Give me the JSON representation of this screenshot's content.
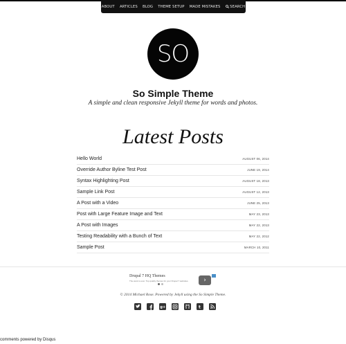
{
  "nav": {
    "items": [
      "ABOUT",
      "ARTICLES",
      "BLOG",
      "THEME SETUP",
      "MADE MISTAKES"
    ],
    "search_label": "SEARCH",
    "search_icon": "search-icon"
  },
  "logo": {
    "text": "SO"
  },
  "site": {
    "title": "So Simple Theme",
    "description": "A simple and clean responsive Jekyll theme for words and photos."
  },
  "main": {
    "heading": "Latest Posts"
  },
  "posts": [
    {
      "title": "Hello World",
      "date": "AUGUST 06, 2014"
    },
    {
      "title": "Override Author Byline Test Post",
      "date": "JUNE 19, 2014"
    },
    {
      "title": "Syntax Highlighting Post",
      "date": "AUGUST 18, 2013"
    },
    {
      "title": "Sample Link Post",
      "date": "AUGUST 12, 2013"
    },
    {
      "title": "A Post with a Video",
      "date": "JUNE 25, 2013"
    },
    {
      "title": "Post with Large Feature Image and Text",
      "date": "MAY 23, 2013"
    },
    {
      "title": "A Post with Images",
      "date": "MAY 22, 2013"
    },
    {
      "title": "Testing Readability with a Bunch of Text",
      "date": "MAY 22, 2012"
    },
    {
      "title": "Sample Post",
      "date": "MARCH 10, 2011"
    }
  ],
  "ad": {
    "title": "Drupal 7 HQ Themes",
    "text": "The want to ever. Top quality themes for your Drupal 7 websites.",
    "button_glyph": "›"
  },
  "footer": {
    "copyright": "© 2014 Michael Rose. Powered by Jekyll using the So Simple Theme.",
    "social": [
      "twitter-icon",
      "facebook-icon",
      "google-plus-icon",
      "instagram-icon",
      "github-icon",
      "tumblr-icon",
      "rss-icon"
    ]
  },
  "disqus": {
    "text": "comments powered by Disqus"
  },
  "colors": {
    "nav_bg": "#111111",
    "logo_bg": "#050505",
    "text": "#222222",
    "divider": "#e6e6e6"
  }
}
